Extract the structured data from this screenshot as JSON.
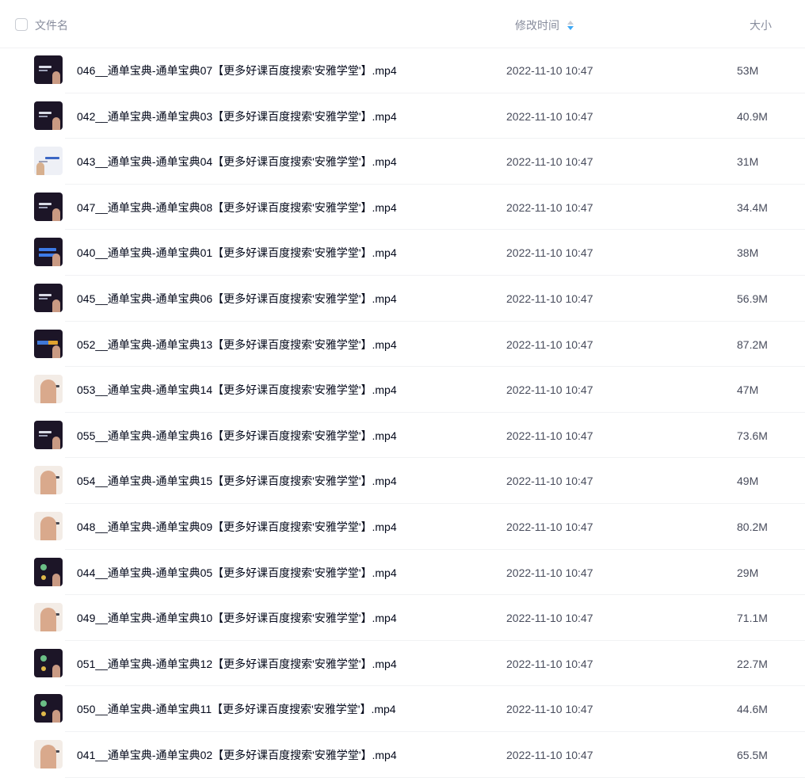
{
  "header": {
    "name_label": "文件名",
    "time_label": "修改时间",
    "size_label": "大小",
    "sort_icon": "sort-icon",
    "accent_color": "#3da8f5"
  },
  "files": [
    {
      "name": "046__通单宝典-通单宝典07【更多好课百度搜索'安雅学堂'】.mp4",
      "time": "2022-11-10 10:47",
      "size": "53M",
      "thumb": "dark"
    },
    {
      "name": "042__通单宝典-通单宝典03【更多好课百度搜索'安雅学堂'】.mp4",
      "time": "2022-11-10 10:47",
      "size": "40.9M",
      "thumb": "dark"
    },
    {
      "name": "043__通单宝典-通单宝典04【更多好课百度搜索'安雅学堂'】.mp4",
      "time": "2022-11-10 10:47",
      "size": "31M",
      "thumb": "light"
    },
    {
      "name": "047__通单宝典-通单宝典08【更多好课百度搜索'安雅学堂'】.mp4",
      "time": "2022-11-10 10:47",
      "size": "34.4M",
      "thumb": "dark"
    },
    {
      "name": "040__通单宝典-通单宝典01【更多好课百度搜索'安雅学堂'】.mp4",
      "time": "2022-11-10 10:47",
      "size": "38M",
      "thumb": "blue"
    },
    {
      "name": "045__通单宝典-通单宝典06【更多好课百度搜索'安雅学堂'】.mp4",
      "time": "2022-11-10 10:47",
      "size": "56.9M",
      "thumb": "dark"
    },
    {
      "name": "052__通单宝典-通单宝典13【更多好课百度搜索'安雅学堂'】.mp4",
      "time": "2022-11-10 10:47",
      "size": "87.2M",
      "thumb": "colorful"
    },
    {
      "name": "053__通单宝典-通单宝典14【更多好课百度搜索'安雅学堂'】.mp4",
      "time": "2022-11-10 10:47",
      "size": "47M",
      "thumb": "bright"
    },
    {
      "name": "055__通单宝典-通单宝典16【更多好课百度搜索'安雅学堂'】.mp4",
      "time": "2022-11-10 10:47",
      "size": "73.6M",
      "thumb": "dark"
    },
    {
      "name": "054__通单宝典-通单宝典15【更多好课百度搜索'安雅学堂'】.mp4",
      "time": "2022-11-10 10:47",
      "size": "49M",
      "thumb": "bright"
    },
    {
      "name": "048__通单宝典-通单宝典09【更多好课百度搜索'安雅学堂'】.mp4",
      "time": "2022-11-10 10:47",
      "size": "80.2M",
      "thumb": "bright"
    },
    {
      "name": "044__通单宝典-通单宝典05【更多好课百度搜索'安雅学堂'】.mp4",
      "time": "2022-11-10 10:47",
      "size": "29M",
      "thumb": "green"
    },
    {
      "name": "049__通单宝典-通单宝典10【更多好课百度搜索'安雅学堂'】.mp4",
      "time": "2022-11-10 10:47",
      "size": "71.1M",
      "thumb": "bright"
    },
    {
      "name": "051__通单宝典-通单宝典12【更多好课百度搜索'安雅学堂'】.mp4",
      "time": "2022-11-10 10:47",
      "size": "22.7M",
      "thumb": "green"
    },
    {
      "name": "050__通单宝典-通单宝典11【更多好课百度搜索'安雅学堂'】.mp4",
      "time": "2022-11-10 10:47",
      "size": "44.6M",
      "thumb": "green"
    },
    {
      "name": "041__通单宝典-通单宝典02【更多好课百度搜索'安雅学堂'】.mp4",
      "time": "2022-11-10 10:47",
      "size": "65.5M",
      "thumb": "bright"
    }
  ]
}
